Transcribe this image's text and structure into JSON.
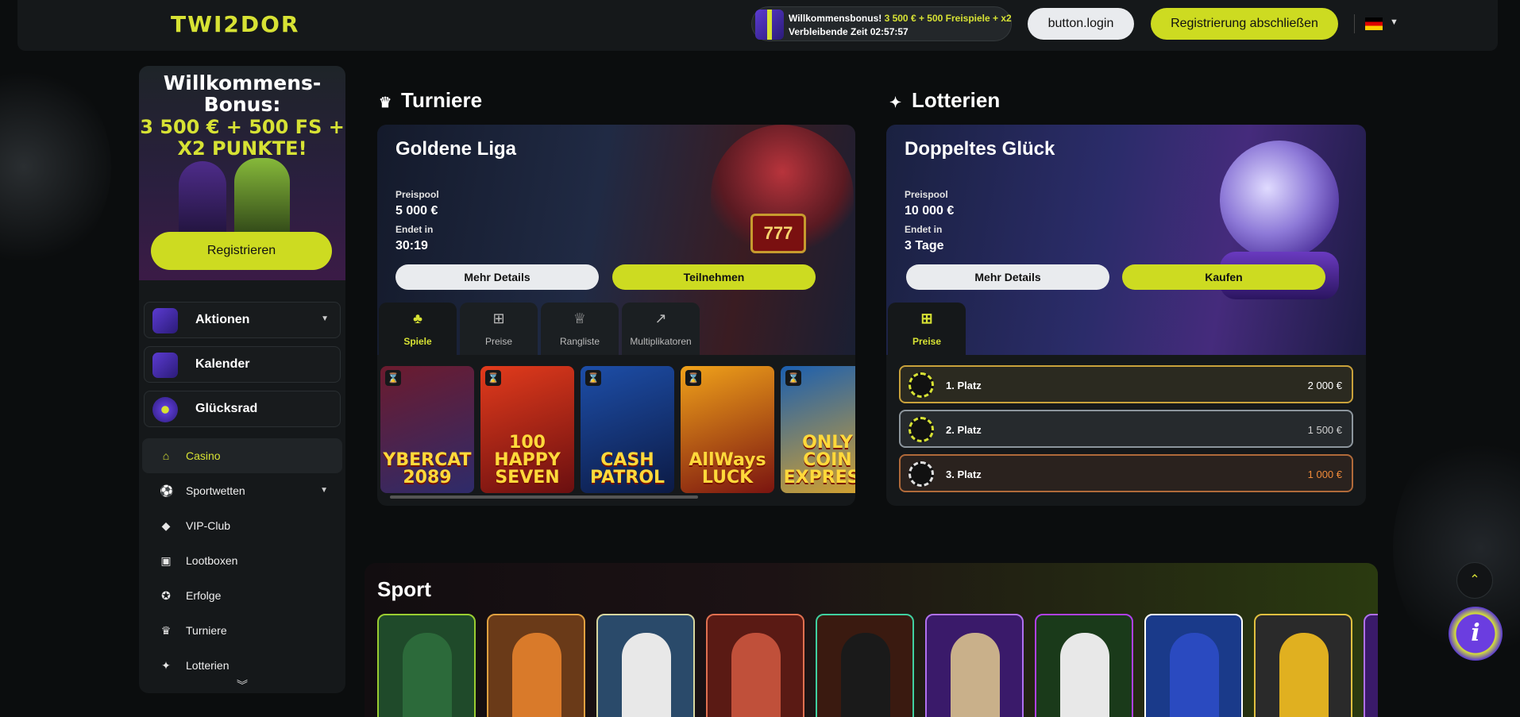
{
  "header": {
    "logo": "TWI2DOR",
    "bonus_line1_prefix": "Willkommensbonus! ",
    "bonus_line1_highlight": "3 500 € + 500 Freispiele + x2",
    "bonus_line2": "Verbleibende Zeit 02:57:57",
    "login_label": "button.login",
    "register_label": "Registrierung abschließen",
    "language": "de"
  },
  "sidebar": {
    "promo_title": "Willkommens-Bonus:",
    "promo_sub": "3 500 € + 500 FS + X2 PUNKTE!",
    "register_label": "Registrieren",
    "cards": [
      {
        "label": "Aktionen",
        "icon": "gift-icon",
        "has_caret": true
      },
      {
        "label": "Kalender",
        "icon": "calendar-icon",
        "has_caret": false
      },
      {
        "label": "Glücksrad",
        "icon": "wheel-icon",
        "has_caret": false
      }
    ],
    "nav": [
      {
        "label": "Casino",
        "icon": "home-icon",
        "active": true
      },
      {
        "label": "Sportwetten",
        "icon": "ball-icon",
        "has_caret": true
      },
      {
        "label": "VIP-Club",
        "icon": "diamond-icon"
      },
      {
        "label": "Lootboxen",
        "icon": "box-icon"
      },
      {
        "label": "Erfolge",
        "icon": "medal-icon"
      },
      {
        "label": "Turniere",
        "icon": "trophy-icon"
      },
      {
        "label": "Lotterien",
        "icon": "lottery-icon"
      }
    ],
    "more_icon": "double-chevron-down-icon"
  },
  "tournaments": {
    "heading": "Turniere",
    "card": {
      "title": "Goldene Liga",
      "prize_label": "Preispool",
      "prize_value": "5 000 €",
      "ends_label": "Endet in",
      "ends_value": "30:19",
      "details_label": "Mehr Details",
      "join_label": "Teilnehmen"
    },
    "tabs": [
      {
        "label": "Spiele",
        "icon": "cherry-icon",
        "active": true
      },
      {
        "label": "Preise",
        "icon": "gift-icon"
      },
      {
        "label": "Rangliste",
        "icon": "crown-icon"
      },
      {
        "label": "Multiplikatoren",
        "icon": "chart-up-icon"
      }
    ],
    "games": [
      {
        "title": "YBERCAT 2089",
        "colors": [
          "#6c1b2e",
          "#2e2b6a"
        ]
      },
      {
        "title": "100 HAPPY SEVEN",
        "colors": [
          "#e23b1c",
          "#6a0f10"
        ]
      },
      {
        "title": "CASH PATROL",
        "colors": [
          "#1d4ea8",
          "#0c1a44"
        ]
      },
      {
        "title": "AllWays LUCK",
        "colors": [
          "#f0a21a",
          "#7a1410"
        ]
      },
      {
        "title": "ONLY COIN EXPRESS",
        "colors": [
          "#1b5fb0",
          "#d8a32b"
        ]
      }
    ]
  },
  "lotteries": {
    "heading": "Lotterien",
    "card": {
      "title": "Doppeltes Glück",
      "prize_label": "Preispool",
      "prize_value": "10 000 €",
      "ends_label": "Endet in",
      "ends_value": "3 Tage",
      "details_label": "Mehr Details",
      "buy_label": "Kaufen"
    },
    "tab": {
      "label": "Preise",
      "icon": "gift-icon"
    },
    "places": [
      {
        "label": "1. Platz",
        "value": "2 000 €",
        "border": "#c9a13b",
        "bg": "#2b2a20",
        "value_color": "#ffffff"
      },
      {
        "label": "2. Platz",
        "value": "1 500 €",
        "border": "#8d969d",
        "bg": "#262a2d",
        "value_color": "#cfcfcf"
      },
      {
        "label": "3. Platz",
        "value": "1 000 €",
        "border": "#b06a3a",
        "bg": "#2a221e",
        "value_color": "#f08a3a"
      }
    ]
  },
  "sport": {
    "heading": "Sport",
    "cards": [
      {
        "border": "#9acd32",
        "bg": "#1f4a2a",
        "fig": "#2c6a3a"
      },
      {
        "border": "#e0a040",
        "bg": "#6a3a18",
        "fig": "#d97a2a"
      },
      {
        "border": "#d7d7a0",
        "bg": "#2a4a6a",
        "fig": "#e8e8e8"
      },
      {
        "border": "#e07050",
        "bg": "#5a1a14",
        "fig": "#c0503a"
      },
      {
        "border": "#40d0a0",
        "bg": "#3a1a10",
        "fig": "#1a1a1a"
      },
      {
        "border": "#b070f0",
        "bg": "#3a1a6a",
        "fig": "#c9b08a"
      },
      {
        "border": "#b040f0",
        "bg": "#1a3a1a",
        "fig": "#e8e8e8"
      },
      {
        "border": "#ffffff",
        "bg": "#1a3a8a",
        "fig": "#2a4ac0"
      },
      {
        "border": "#e0c040",
        "bg": "#2a2a2a",
        "fig": "#e0b020"
      },
      {
        "border": "#b070f0",
        "bg": "#3a1a6a",
        "fig": "#7a4ab0"
      }
    ]
  },
  "floating": {
    "up_icon": "chevron-up-icon",
    "info_icon": "info-icon",
    "info_text": "i"
  }
}
